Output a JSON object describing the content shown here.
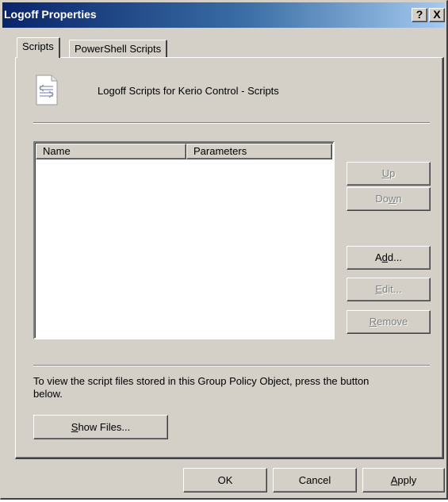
{
  "window": {
    "title": "Logoff Properties",
    "help_label": "?",
    "close_label": "X"
  },
  "tabs": [
    {
      "label": "Scripts",
      "active": true
    },
    {
      "label": "PowerShell Scripts",
      "active": false
    }
  ],
  "scripts_panel": {
    "heading": "Logoff Scripts for Kerio Control - Scripts",
    "icon": "script-document-icon",
    "list": {
      "columns": [
        "Name",
        "Parameters"
      ],
      "rows": []
    },
    "side_buttons": {
      "up": {
        "pre": "",
        "key": "U",
        "post": "p",
        "enabled": false
      },
      "down": {
        "pre": "Do",
        "key": "w",
        "post": "n",
        "enabled": false
      },
      "add": {
        "pre": "A",
        "key": "d",
        "post": "d...",
        "enabled": true
      },
      "edit": {
        "pre": "",
        "key": "E",
        "post": "dit...",
        "enabled": false
      },
      "remove": {
        "pre": "",
        "key": "R",
        "post": "emove",
        "enabled": false
      }
    },
    "info_text": "To view the script files stored in this Group Policy Object, press the button below.",
    "show_files": {
      "pre": "",
      "key": "S",
      "post": "how Files..."
    }
  },
  "footer": {
    "ok": "OK",
    "cancel": "Cancel",
    "apply": {
      "pre": "",
      "key": "A",
      "post": "pply"
    }
  },
  "colors": {
    "face": "#d4d0c8",
    "titlebar_start": "#0a246a",
    "titlebar_end": "#a6caf0",
    "disabled_text": "#808080"
  }
}
